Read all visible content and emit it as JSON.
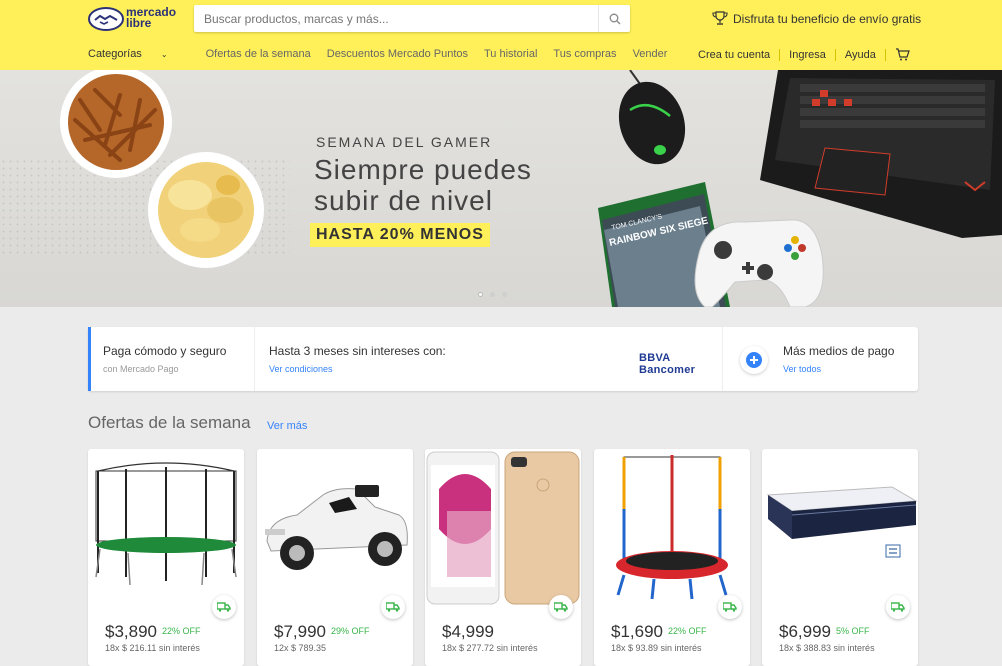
{
  "header": {
    "logo_line1": "mercado",
    "logo_line2": "libre",
    "search_placeholder": "Buscar productos, marcas y más...",
    "promo": "Disfruta tu beneficio de envío gratis",
    "categories": "Categorías",
    "nav_left": [
      "Ofertas de la semana",
      "Descuentos Mercado Puntos",
      "Tu historial",
      "Tus compras",
      "Vender"
    ],
    "nav_right": [
      "Crea tu cuenta",
      "Ingresa",
      "Ayuda"
    ],
    "accent": "#fff059"
  },
  "banner": {
    "kicker": "SEMANA DEL GAMER",
    "title": "Siempre puedes subir de nivel",
    "tag": "HASTA 20% MENOS",
    "game_title": "RAINBOW SIX SIEGE",
    "game_brand": "TOM CLANCY'S"
  },
  "payment": {
    "cell1_main": "Paga cómodo y seguro",
    "cell1_sub": "con Mercado Pago",
    "cell2_main": "Hasta 3 meses sin intereses con:",
    "cell2_link": "Ver condiciones",
    "bank": "BBVA Bancomer",
    "cell3_main": "Más medios de pago",
    "cell3_link": "Ver todos"
  },
  "offers": {
    "title": "Ofertas de la semana",
    "link": "Ver más",
    "items": [
      {
        "price": "$3,890",
        "off": "22% OFF",
        "inst": "18x $ 216.11 sin interés",
        "product": "trampoline-image"
      },
      {
        "price": "$7,990",
        "off": "29% OFF",
        "inst": "12x $ 789.35",
        "product": "ride-on-car-image"
      },
      {
        "price": "$4,999",
        "off": "",
        "inst": "18x $ 277.72 sin interés",
        "product": "smartphone-image"
      },
      {
        "price": "$1,690",
        "off": "22% OFF",
        "inst": "18x $ 93.89 sin interés",
        "product": "kids-trampoline-image"
      },
      {
        "price": "$6,999",
        "off": "5% OFF",
        "inst": "18x $ 388.83 sin interés",
        "product": "mattress-image"
      }
    ]
  }
}
